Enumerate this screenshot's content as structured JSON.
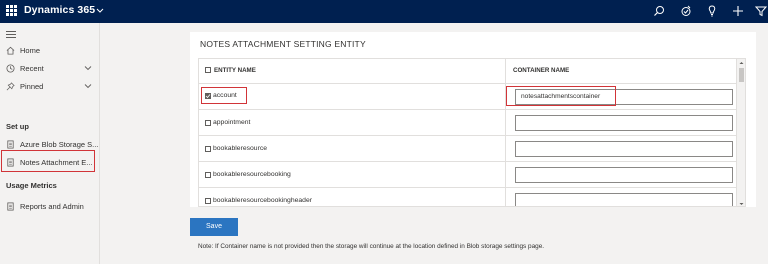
{
  "header": {
    "app_title": "Dynamics 365",
    "icons": [
      "waffle-icon",
      "chevron-down-icon",
      "search-icon",
      "task-icon",
      "lightbulb-icon",
      "plus-icon",
      "filter-icon"
    ]
  },
  "sidebar": {
    "items": [
      {
        "label": "Home",
        "icon": "home-icon"
      },
      {
        "label": "Recent",
        "icon": "clock-icon"
      },
      {
        "label": "Pinned",
        "icon": "pin-icon"
      }
    ],
    "setup_header": "Set up",
    "setup_items": [
      {
        "label": "Azure Blob Storage S...",
        "icon": "document-icon"
      },
      {
        "label": "Notes Attachment E...",
        "icon": "document-icon"
      }
    ],
    "usage_header": "Usage Metrics",
    "usage_items": [
      {
        "label": "Reports and Admin",
        "icon": "document-icon"
      }
    ]
  },
  "main": {
    "card_title": "NOTES ATTACHMENT SETTING ENTITY",
    "columns": {
      "entity": "ENTITY NAME",
      "container": "CONTAINER NAME"
    },
    "rows": [
      {
        "entity": "account",
        "checked": true,
        "container": "notesattachmentscontainer"
      },
      {
        "entity": "appointment",
        "checked": false,
        "container": ""
      },
      {
        "entity": "bookableresource",
        "checked": false,
        "container": ""
      },
      {
        "entity": "bookableresourcebooking",
        "checked": false,
        "container": ""
      },
      {
        "entity": "bookableresourcebookingheader",
        "checked": false,
        "container": ""
      }
    ],
    "save_label": "Save",
    "note": "Note: If Container name is not provided then the storage will continue at the location defined in Blob storage settings page."
  },
  "colors": {
    "topbar": "#002050",
    "button": "#2b75c1",
    "highlight": "#d13438"
  }
}
